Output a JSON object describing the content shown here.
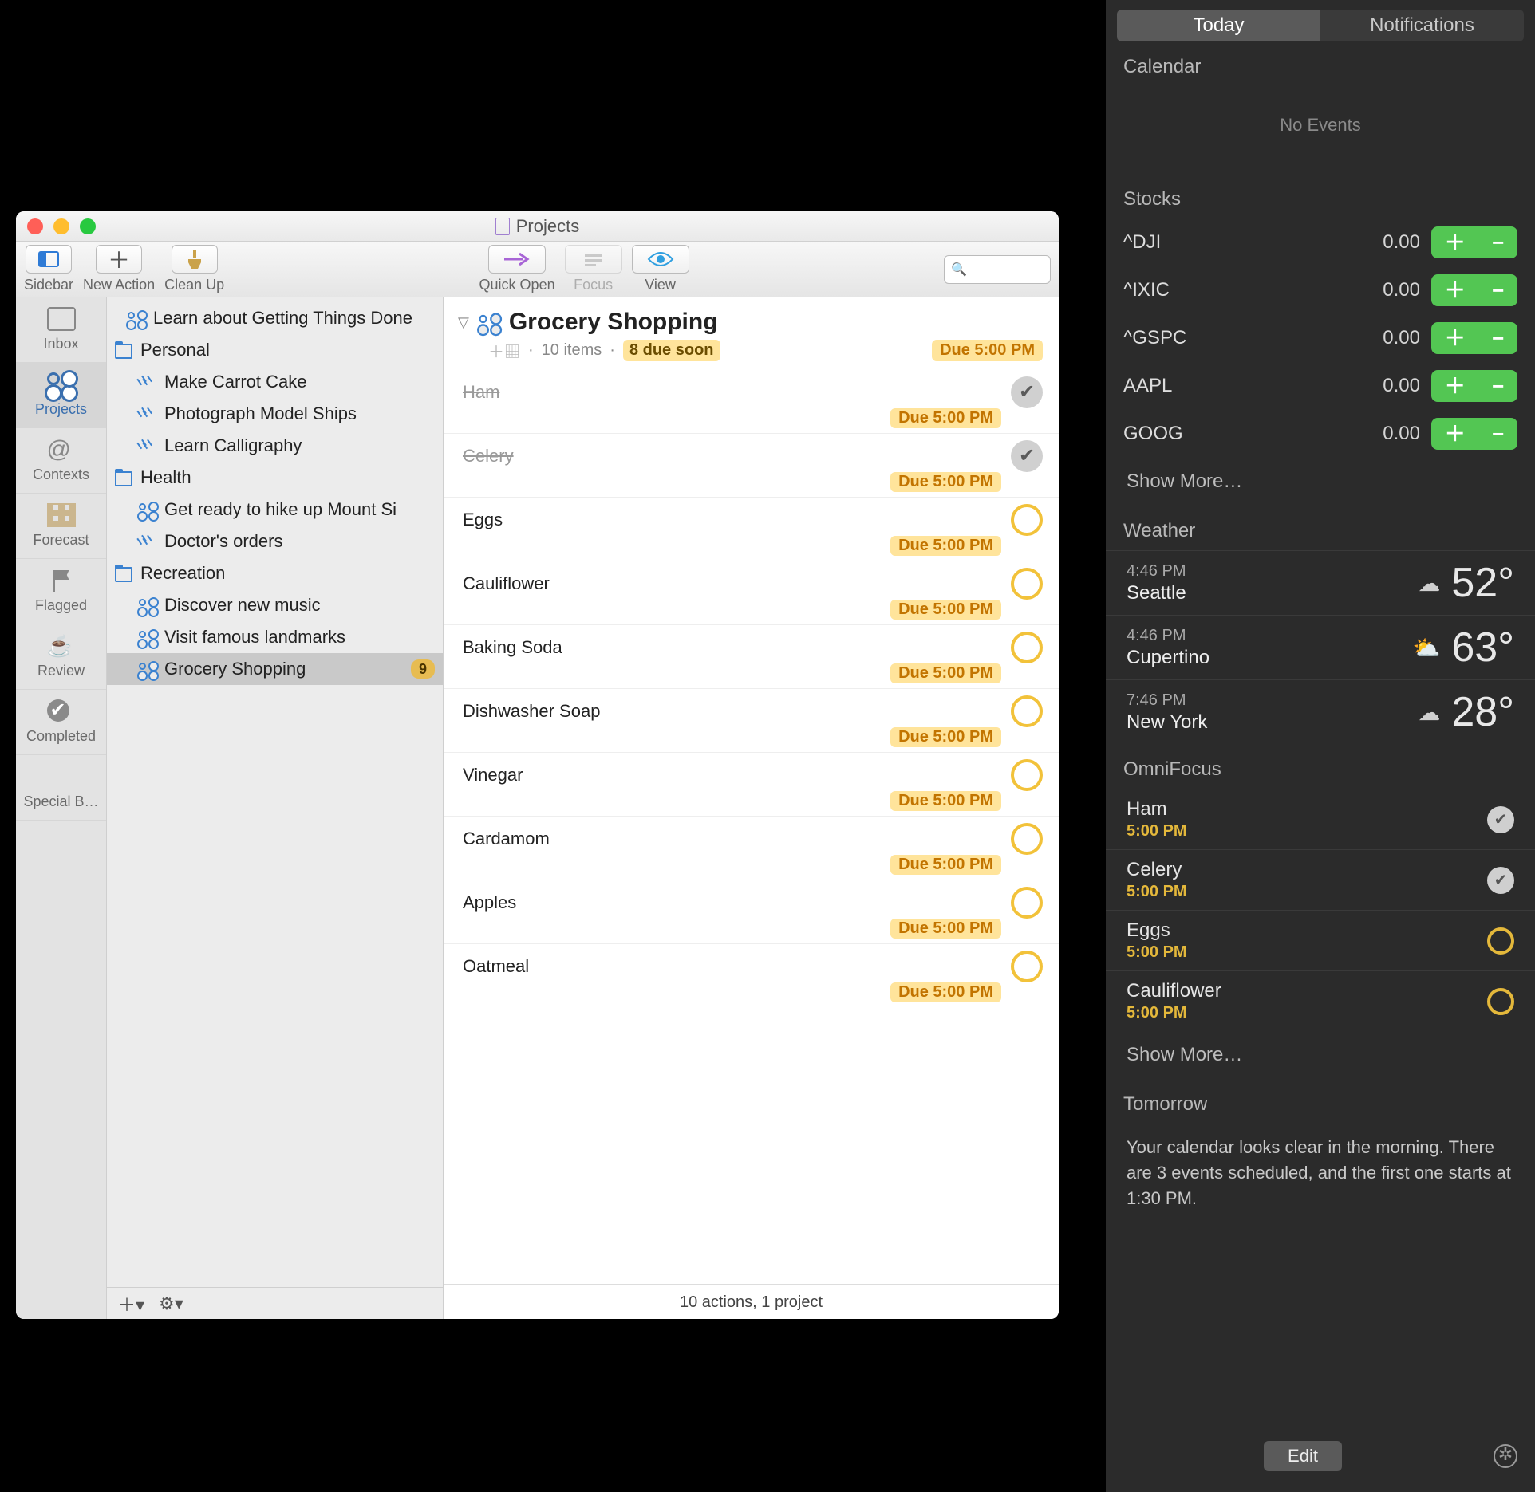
{
  "app": {
    "window_title": "Projects",
    "toolbar": {
      "sidebar": "Sidebar",
      "new_action": "New Action",
      "clean_up": "Clean Up",
      "quick_open": "Quick Open",
      "focus": "Focus",
      "view": "View"
    },
    "rail": [
      {
        "id": "inbox",
        "label": "Inbox"
      },
      {
        "id": "projects",
        "label": "Projects",
        "selected": true
      },
      {
        "id": "contexts",
        "label": "Contexts"
      },
      {
        "id": "forecast",
        "label": "Forecast"
      },
      {
        "id": "flagged",
        "label": "Flagged"
      },
      {
        "id": "review",
        "label": "Review"
      },
      {
        "id": "completed",
        "label": "Completed"
      },
      {
        "id": "specialb",
        "label": "Special B…"
      }
    ],
    "tree": [
      {
        "type": "project",
        "icon": "sequential",
        "label": "Learn about Getting Things Done"
      },
      {
        "type": "folder",
        "label": "Personal"
      },
      {
        "type": "project",
        "icon": "parallel",
        "label": "Make Carrot Cake",
        "indent": true
      },
      {
        "type": "project",
        "icon": "parallel",
        "label": "Photograph Model Ships",
        "indent": true
      },
      {
        "type": "project",
        "icon": "parallel",
        "label": "Learn Calligraphy",
        "indent": true
      },
      {
        "type": "folder",
        "label": "Health"
      },
      {
        "type": "project",
        "icon": "sequential",
        "label": "Get ready to hike up Mount Si",
        "indent": true
      },
      {
        "type": "project",
        "icon": "parallel",
        "label": "Doctor's orders",
        "indent": true
      },
      {
        "type": "folder",
        "label": "Recreation"
      },
      {
        "type": "project",
        "icon": "sequential",
        "label": "Discover new music",
        "indent": true
      },
      {
        "type": "project",
        "icon": "sequential",
        "label": "Visit famous landmarks",
        "indent": true
      },
      {
        "type": "project",
        "icon": "sequential",
        "label": "Grocery Shopping",
        "indent": true,
        "selected": true,
        "badge": "9"
      }
    ],
    "main": {
      "title": "Grocery Shopping",
      "item_count": "10 items",
      "due_soon": "8 due soon",
      "due": "Due 5:00 PM",
      "tasks": [
        {
          "title": "Ham",
          "done": true,
          "due": "Due 5:00 PM"
        },
        {
          "title": "Celery",
          "done": true,
          "due": "Due 5:00 PM"
        },
        {
          "title": "Eggs",
          "done": false,
          "due": "Due 5:00 PM"
        },
        {
          "title": "Cauliflower",
          "done": false,
          "due": "Due 5:00 PM"
        },
        {
          "title": "Baking Soda",
          "done": false,
          "due": "Due 5:00 PM"
        },
        {
          "title": "Dishwasher Soap",
          "done": false,
          "due": "Due 5:00 PM"
        },
        {
          "title": "Vinegar",
          "done": false,
          "due": "Due 5:00 PM"
        },
        {
          "title": "Cardamom",
          "done": false,
          "due": "Due 5:00 PM"
        },
        {
          "title": "Apples",
          "done": false,
          "due": "Due 5:00 PM"
        },
        {
          "title": "Oatmeal",
          "done": false,
          "due": "Due 5:00 PM"
        }
      ],
      "footer": "10 actions, 1 project"
    }
  },
  "nc": {
    "tabs": {
      "today": "Today",
      "notifications": "Notifications",
      "selected": "today"
    },
    "calendar": {
      "header": "Calendar",
      "no_events": "No Events"
    },
    "stocks": {
      "header": "Stocks",
      "rows": [
        {
          "sym": "^DJI",
          "val": "0.00"
        },
        {
          "sym": "^IXIC",
          "val": "0.00"
        },
        {
          "sym": "^GSPC",
          "val": "0.00"
        },
        {
          "sym": "AAPL",
          "val": "0.00"
        },
        {
          "sym": "GOOG",
          "val": "0.00"
        }
      ],
      "show_more": "Show More…"
    },
    "weather": {
      "header": "Weather",
      "rows": [
        {
          "time": "4:46 PM",
          "city": "Seattle",
          "icon": "☁",
          "temp": "52°"
        },
        {
          "time": "4:46 PM",
          "city": "Cupertino",
          "icon": "⛅",
          "temp": "63°"
        },
        {
          "time": "7:46 PM",
          "city": "New York",
          "icon": "☁",
          "temp": "28°"
        }
      ]
    },
    "omnifocus": {
      "header": "OmniFocus",
      "rows": [
        {
          "title": "Ham",
          "time": "5:00 PM",
          "done": true
        },
        {
          "title": "Celery",
          "time": "5:00 PM",
          "done": true
        },
        {
          "title": "Eggs",
          "time": "5:00 PM",
          "done": false
        },
        {
          "title": "Cauliflower",
          "time": "5:00 PM",
          "done": false
        }
      ],
      "show_more": "Show More…"
    },
    "tomorrow": {
      "header": "Tomorrow",
      "text": "Your calendar looks clear in the morning. There are 3 events scheduled, and the first one starts at 1:30 PM."
    },
    "edit": "Edit"
  }
}
